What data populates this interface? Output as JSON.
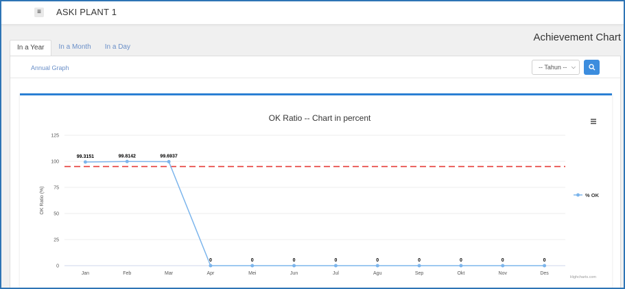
{
  "app": {
    "title": "ASKI PLANT 1",
    "menu_icon": "hamburger-icon"
  },
  "page": {
    "title": "Achievement Chart"
  },
  "tabs": [
    {
      "label": "In a Year",
      "active": true
    },
    {
      "label": "In a Month",
      "active": false
    },
    {
      "label": "In a Day",
      "active": false
    }
  ],
  "sub_header": {
    "link": "Annual Graph",
    "select_value": "-- Tahun --",
    "search_icon": "search-icon"
  },
  "colors": {
    "accent": "#2a7fd4",
    "series": "#7cb5ec",
    "target_line": "#e53935"
  },
  "chart_data": {
    "type": "line",
    "title": "OK Ratio -- Chart in percent",
    "ylabel": "OK Ratio (%)",
    "xlabel": "",
    "categories": [
      "Jan",
      "Feb",
      "Mar",
      "Apr",
      "Mei",
      "Jun",
      "Jul",
      "Agu",
      "Sep",
      "Okt",
      "Nov",
      "Des"
    ],
    "series": [
      {
        "name": "% OK",
        "values": [
          99.3151,
          99.8142,
          99.6937,
          0,
          0,
          0,
          0,
          0,
          0,
          0,
          0,
          0
        ],
        "data_labels": [
          "99.3151",
          "99.8142",
          "99.6937",
          "0",
          "0",
          "0",
          "0",
          "0",
          "0",
          "0",
          "0",
          "0"
        ]
      }
    ],
    "target_line": 95,
    "ylim": [
      0,
      125
    ],
    "yticks": [
      0,
      25,
      50,
      75,
      100,
      125
    ],
    "grid": true,
    "legend": "right",
    "credit": "Highcharts.com",
    "menu_icon": "chart-menu-icon"
  }
}
